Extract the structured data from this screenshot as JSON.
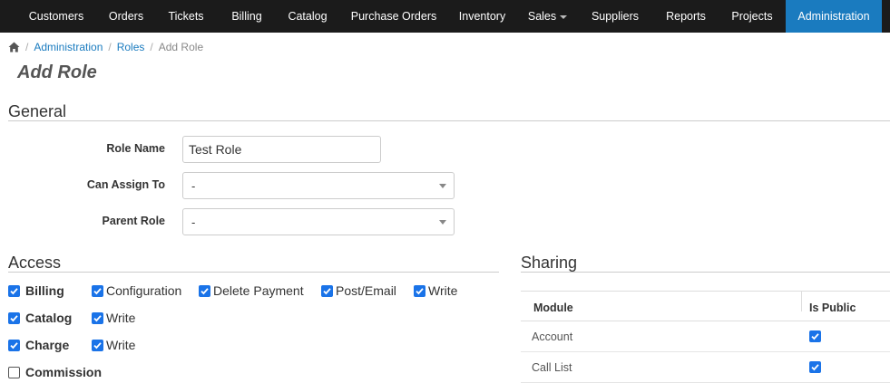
{
  "nav": {
    "items": [
      {
        "label": "Customers"
      },
      {
        "label": "Orders"
      },
      {
        "label": "Tickets"
      },
      {
        "label": "Billing"
      },
      {
        "label": "Catalog"
      },
      {
        "label": "Purchase Orders"
      },
      {
        "label": "Inventory"
      },
      {
        "label": "Sales"
      },
      {
        "label": "Suppliers"
      },
      {
        "label": "Reports"
      },
      {
        "label": "Projects"
      },
      {
        "label": "Administration",
        "active": true
      }
    ],
    "bar_color": "#1b1b1b",
    "active_color": "#1a7bbf"
  },
  "breadcrumb": {
    "home_icon": "home-icon",
    "items": [
      "Administration",
      "Roles"
    ],
    "current": "Add Role"
  },
  "page": {
    "title": "Add Role"
  },
  "general": {
    "title": "General",
    "role_name": {
      "label": "Role Name",
      "value": "Test Role"
    },
    "can_assign_to": {
      "label": "Can Assign To",
      "value": "-"
    },
    "parent_role": {
      "label": "Parent Role",
      "value": "-"
    }
  },
  "access": {
    "title": "Access",
    "rows": [
      {
        "name": "Billing",
        "checked": true,
        "perms": [
          {
            "label": "Configuration",
            "checked": true
          },
          {
            "label": "Delete Payment",
            "checked": true
          },
          {
            "label": "Post/Email",
            "checked": true
          },
          {
            "label": "Write",
            "checked": true
          }
        ]
      },
      {
        "name": "Catalog",
        "checked": true,
        "perms": [
          {
            "label": "Write",
            "checked": true
          }
        ]
      },
      {
        "name": "Charge",
        "checked": true,
        "perms": [
          {
            "label": "Write",
            "checked": true
          }
        ]
      },
      {
        "name": "Commission",
        "checked": false,
        "perms": []
      }
    ]
  },
  "sharing": {
    "title": "Sharing",
    "columns": [
      "Module",
      "Is Public"
    ],
    "rows": [
      {
        "module": "Account",
        "is_public": true
      },
      {
        "module": "Call List",
        "is_public": true
      }
    ]
  },
  "colors": {
    "link": "#1a7bbf",
    "checkbox": "#1a73e8"
  }
}
